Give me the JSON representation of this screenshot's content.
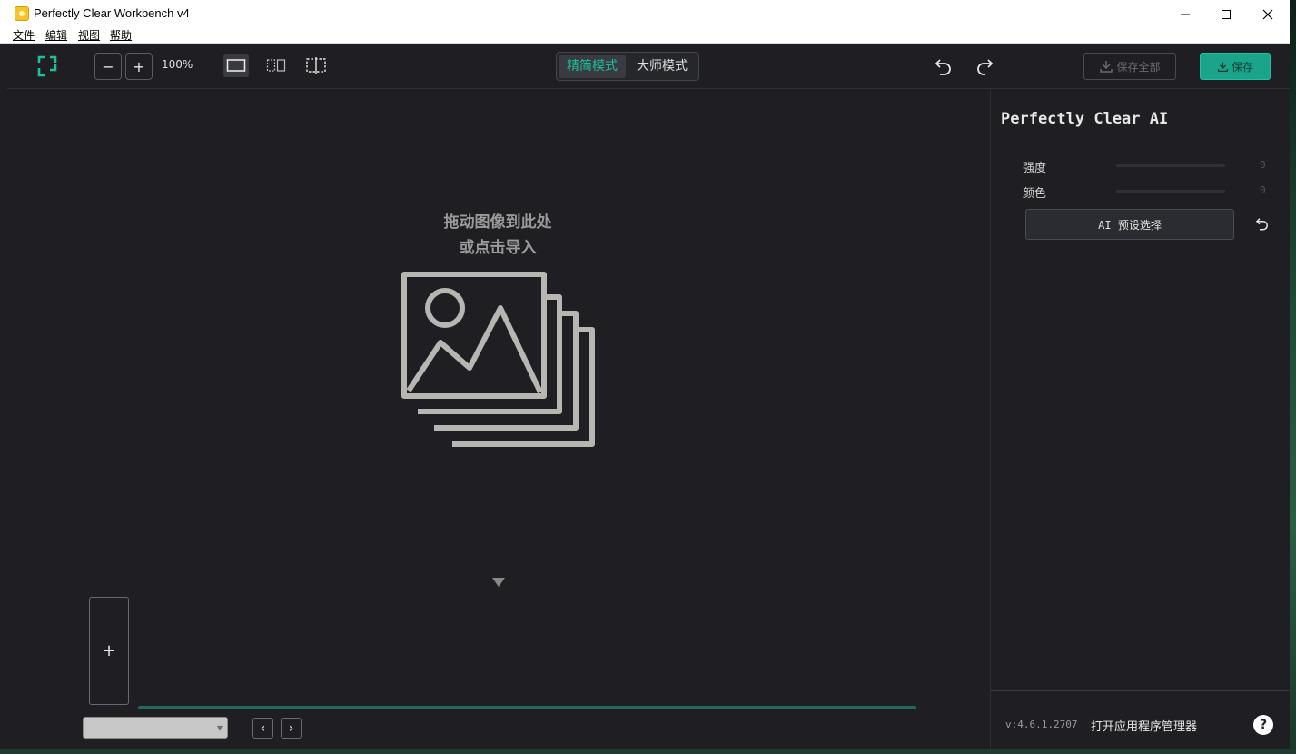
{
  "window": {
    "title": "Perfectly Clear Workbench v4",
    "minimize_icon": "minimize-icon",
    "maximize_icon": "maximize-icon",
    "close_icon": "close-icon"
  },
  "menu": {
    "items": [
      "文件",
      "编辑",
      "视图",
      "帮助"
    ]
  },
  "toolbar": {
    "zoom_out": "−",
    "zoom_in": "+",
    "zoom_level": "100%",
    "modes": [
      {
        "label": "精简模式",
        "active": true
      },
      {
        "label": "大师模式",
        "active": false
      }
    ],
    "save_all_label": "保存全部",
    "save_label": "保存"
  },
  "canvas": {
    "drop_line1": "拖动图像到此处",
    "drop_line2": "或点击导入",
    "add_tile": "+",
    "prev": "‹",
    "next": "›"
  },
  "panel": {
    "title": "Perfectly Clear AI",
    "sliders": [
      {
        "label": "强度",
        "value": "0"
      },
      {
        "label": "颜色",
        "value": "0"
      }
    ],
    "preset_label": "AI 预设选择",
    "version": "v:4.6.1.2707",
    "app_manager": "打开应用程序管理器",
    "help": "?"
  },
  "colors": {
    "accent": "#1aa58a",
    "background": "#1f1f23",
    "active_mode_text": "#1fbf9c"
  }
}
